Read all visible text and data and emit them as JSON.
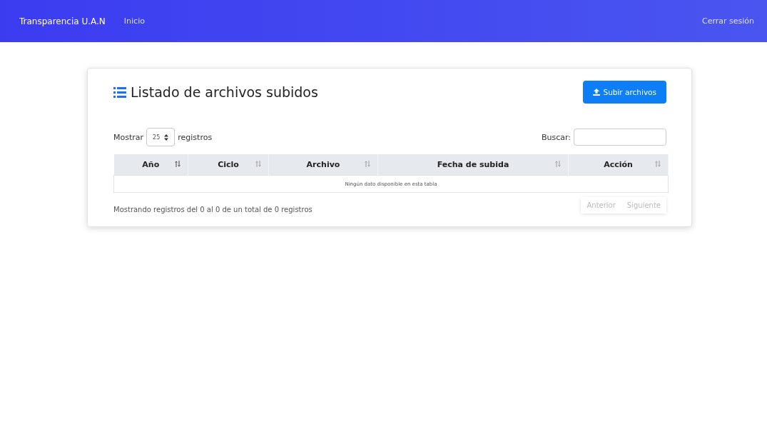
{
  "navbar": {
    "brand": "Transparencia U.A.N",
    "links": [
      {
        "label": "Inicio"
      }
    ],
    "logout": "Cerrar sesión"
  },
  "card": {
    "title": "Listado de archivos subidos",
    "upload_button": "Subir archivos",
    "length": {
      "prefix": "Mostrar",
      "value": "25",
      "suffix": "registros"
    },
    "search": {
      "label": "Buscar:"
    },
    "table": {
      "columns": [
        {
          "label": "Año",
          "sorted": true
        },
        {
          "label": "Ciclo",
          "sorted": false
        },
        {
          "label": "Archivo",
          "sorted": false
        },
        {
          "label": "Fecha de subida",
          "sorted": false
        },
        {
          "label": "Acción",
          "sorted": false
        }
      ],
      "empty_message": "Ningún dato disponible en esta tabla"
    },
    "info": "Mostrando registros del 0 al 0 de un total de 0 registros",
    "pagination": [
      {
        "label": "Anterior",
        "disabled": true
      },
      {
        "label": "Siguiente",
        "disabled": true
      }
    ]
  }
}
